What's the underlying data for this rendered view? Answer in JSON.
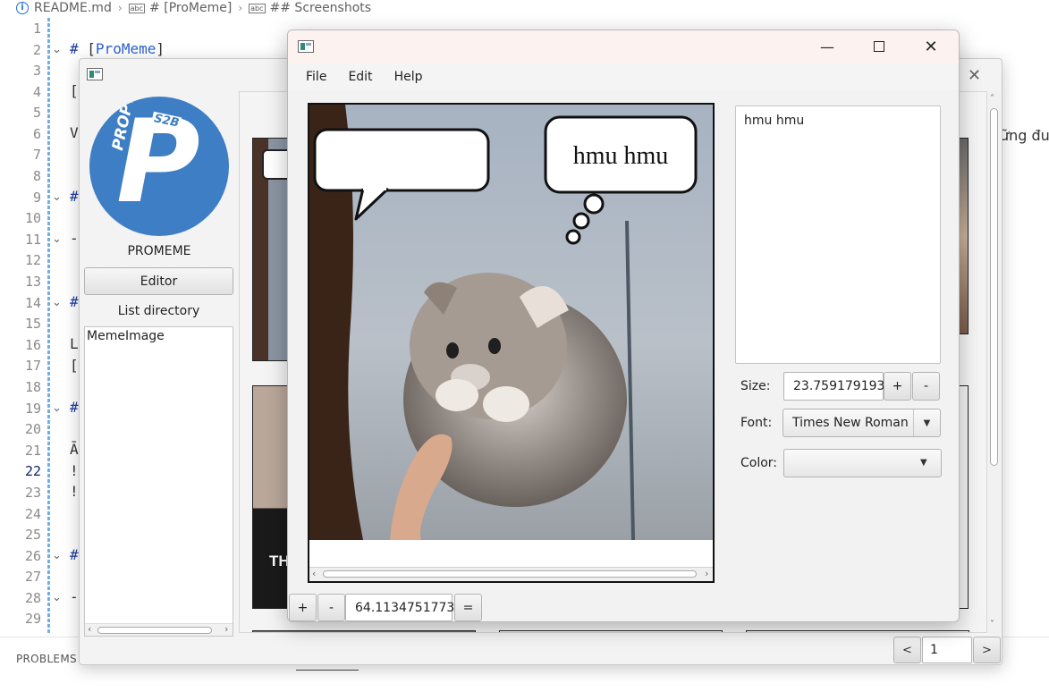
{
  "breadcrumb": {
    "file": "README.md",
    "heading1": "# [ProMeme]",
    "heading2": "## Screenshots"
  },
  "editor": {
    "line_numbers": [
      "1",
      "2",
      "3",
      "4",
      "5",
      "6",
      "7",
      "8",
      "9",
      "10",
      "11",
      "12",
      "13",
      "14",
      "15",
      "16",
      "17",
      "18",
      "19",
      "20",
      "21",
      "22",
      "23",
      "24",
      "25",
      "26",
      "27",
      "28",
      "29"
    ],
    "active_line": "22",
    "line2_hash": "#",
    "line2_open": "[",
    "line2_link": "ProMeme",
    "line2_close": "]",
    "line4": "[",
    "line6": "V",
    "line9": "#",
    "line11": "-",
    "line14": "#",
    "line16": "L",
    "line17": "[",
    "line19": "#",
    "line21": "Ā",
    "line22": "!",
    "line23": "!",
    "line26": "#",
    "line28": "-",
    "right_overflow_text": "ững đu"
  },
  "panel": {
    "problems_label": "PROBLEMS"
  },
  "gallery_window": {
    "brand_name": "PROMEME",
    "logo_text": "PROPTIT",
    "logo_badge": "S2B",
    "logo_letter": "P",
    "editor_button": "Editor",
    "list_label": "List directory",
    "directory_items": [
      "MemeImage"
    ],
    "thumb_caption": "TH",
    "pager": {
      "prev": "<",
      "page": "1",
      "next": ">"
    }
  },
  "meme_editor": {
    "menu": [
      "File",
      "Edit",
      "Help"
    ],
    "bubble_text": "hmu hmu",
    "text_content": "hmu hmu",
    "size_label": "Size:",
    "size_value": "23.759179193",
    "size_plus": "+",
    "size_minus": "-",
    "font_label": "Font:",
    "font_value": "Times New Roman",
    "color_label": "Color:",
    "color_value": "",
    "zoom_plus": "+",
    "zoom_minus": "-",
    "zoom_value": "64.1134751773",
    "zoom_reset": "="
  },
  "colors": {
    "logo_blue": "#3e7ec4",
    "titlebar": "#fcf2ef",
    "heading_blue": "#1b3a9e",
    "link_blue": "#2a5fd0"
  }
}
